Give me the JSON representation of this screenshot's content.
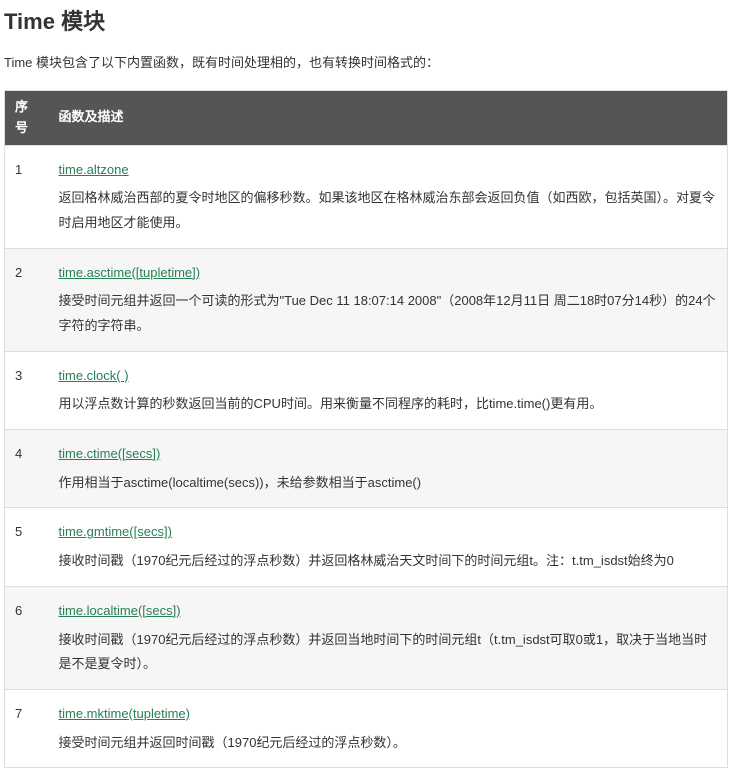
{
  "heading": "Time 模块",
  "intro": "Time 模块包含了以下内置函数，既有时间处理相的，也有转换时间格式的：",
  "headers": [
    "序号",
    "函数及描述"
  ],
  "rows": [
    {
      "num": "1",
      "fn": "time.altzone",
      "desc": "返回格林威治西部的夏令时地区的偏移秒数。如果该地区在格林威治东部会返回负值（如西欧，包括英国）。对夏令时启用地区才能使用。"
    },
    {
      "num": "2",
      "fn": "time.asctime([tupletime])",
      "desc": "接受时间元组并返回一个可读的形式为\"Tue Dec 11 18:07:14 2008\"（2008年12月11日 周二18时07分14秒）的24个字符的字符串。"
    },
    {
      "num": "3",
      "fn": "time.clock( )",
      "desc": "用以浮点数计算的秒数返回当前的CPU时间。用来衡量不同程序的耗时，比time.time()更有用。"
    },
    {
      "num": "4",
      "fn": "time.ctime([secs])",
      "desc": "作用相当于asctime(localtime(secs))，未给参数相当于asctime()"
    },
    {
      "num": "5",
      "fn": "time.gmtime([secs])",
      "desc": "接收时间戳（1970纪元后经过的浮点秒数）并返回格林威治天文时间下的时间元组t。注：t.tm_isdst始终为0"
    },
    {
      "num": "6",
      "fn": "time.localtime([secs])",
      "desc": "接收时间戳（1970纪元后经过的浮点秒数）并返回当地时间下的时间元组t（t.tm_isdst可取0或1，取决于当地当时是不是夏令时）。"
    },
    {
      "num": "7",
      "fn": "time.mktime(tupletime)",
      "desc": "接受时间元组并返回时间戳（1970纪元后经过的浮点秒数）。"
    }
  ]
}
